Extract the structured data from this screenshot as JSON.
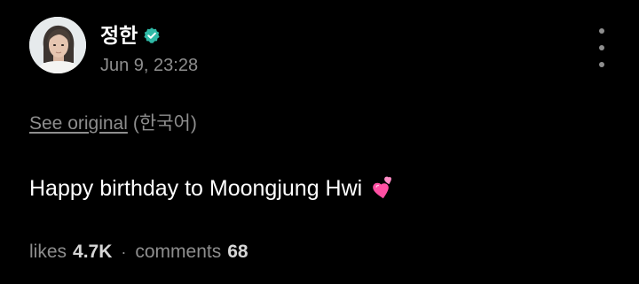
{
  "post": {
    "author": {
      "name": "정한",
      "verified": true,
      "verified_color": "#2fb9a6"
    },
    "timestamp": "Jun 9, 23:28",
    "more_menu_icon": "more-vertical-icon",
    "translation": {
      "see_original_label": "See original",
      "language_tag": "(한국어)"
    },
    "body": "Happy birthday to Moongjung Hwi",
    "body_emoji": "two-hearts-icon",
    "stats": {
      "likes_label": "likes",
      "likes_value": "4.7K",
      "separator": "·",
      "comments_label": "comments",
      "comments_value": "68"
    }
  },
  "colors": {
    "background": "#000000",
    "text_primary": "#ffffff",
    "text_secondary": "#8e8e8e",
    "heart_pink": "#ff4fa3"
  }
}
